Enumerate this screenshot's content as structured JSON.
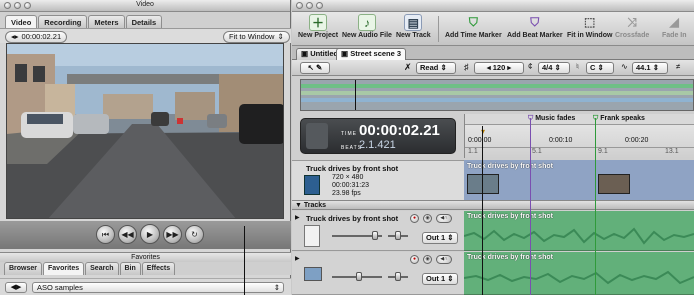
{
  "video_window": {
    "title": "Video",
    "tabs": [
      {
        "label": "Video",
        "active": true
      },
      {
        "label": "Recording"
      },
      {
        "label": "Meters"
      },
      {
        "label": "Details"
      }
    ],
    "timecode": "00:00:02.21",
    "fit_option": "Fit to Window"
  },
  "favorites_window": {
    "title": "Favorites",
    "tabs": [
      {
        "label": "Browser"
      },
      {
        "label": "Favorites",
        "active": true
      },
      {
        "label": "Search"
      },
      {
        "label": "Bin"
      },
      {
        "label": "Effects"
      }
    ],
    "location": "ASO samples"
  },
  "toolbar": {
    "items": [
      {
        "label": "New Project",
        "icon": "new-project-icon"
      },
      {
        "label": "New Audio File",
        "icon": "new-audio-file-icon"
      },
      {
        "label": "New Track",
        "icon": "new-track-icon"
      },
      {
        "label": "Add Time Marker",
        "icon": "time-marker-icon"
      },
      {
        "label": "Add Beat Marker",
        "icon": "beat-marker-icon"
      },
      {
        "label": "Fit in Window",
        "icon": "fit-window-icon"
      },
      {
        "label": "Crossfade",
        "icon": "crossfade-icon",
        "disabled": true
      },
      {
        "label": "Fade In",
        "icon": "fade-in-icon",
        "disabled": true
      }
    ]
  },
  "project_tabs": [
    {
      "label": "Untitled"
    },
    {
      "label": "Street scene 3",
      "active": true
    }
  ],
  "controls": {
    "mode": "Read",
    "tempo": "120",
    "time_signature": "4/4",
    "key": "C",
    "sample_rate": "44.1"
  },
  "time_display": {
    "time_label": "TIME",
    "time_value": "00:00:02.21",
    "beats_label": "BEATS",
    "beats_value": "2.1.421"
  },
  "ruler": {
    "markers": [
      {
        "label": "Music fades",
        "color": "#7a4fb0"
      },
      {
        "label": "Frank speaks",
        "color": "#2f9a3a"
      }
    ],
    "time_ticks": [
      "0:00:00",
      "0:00:10",
      "0:00:20"
    ],
    "beat_ticks": [
      "1.1",
      "5.1",
      "9.1",
      "13.1"
    ]
  },
  "video_clip": {
    "name": "Truck drives by front shot",
    "resolution": "720 × 480",
    "duration": "00:00:31:23",
    "fps": "23.98 fps"
  },
  "tracks_label": "Tracks",
  "tracks": [
    {
      "name": "Truck drives by front shot",
      "output": "Out 1",
      "clip_label": "Truck drives by front shot"
    },
    {
      "name": "",
      "output": "Out 1",
      "clip_label": "Truck drives by front shot"
    }
  ]
}
